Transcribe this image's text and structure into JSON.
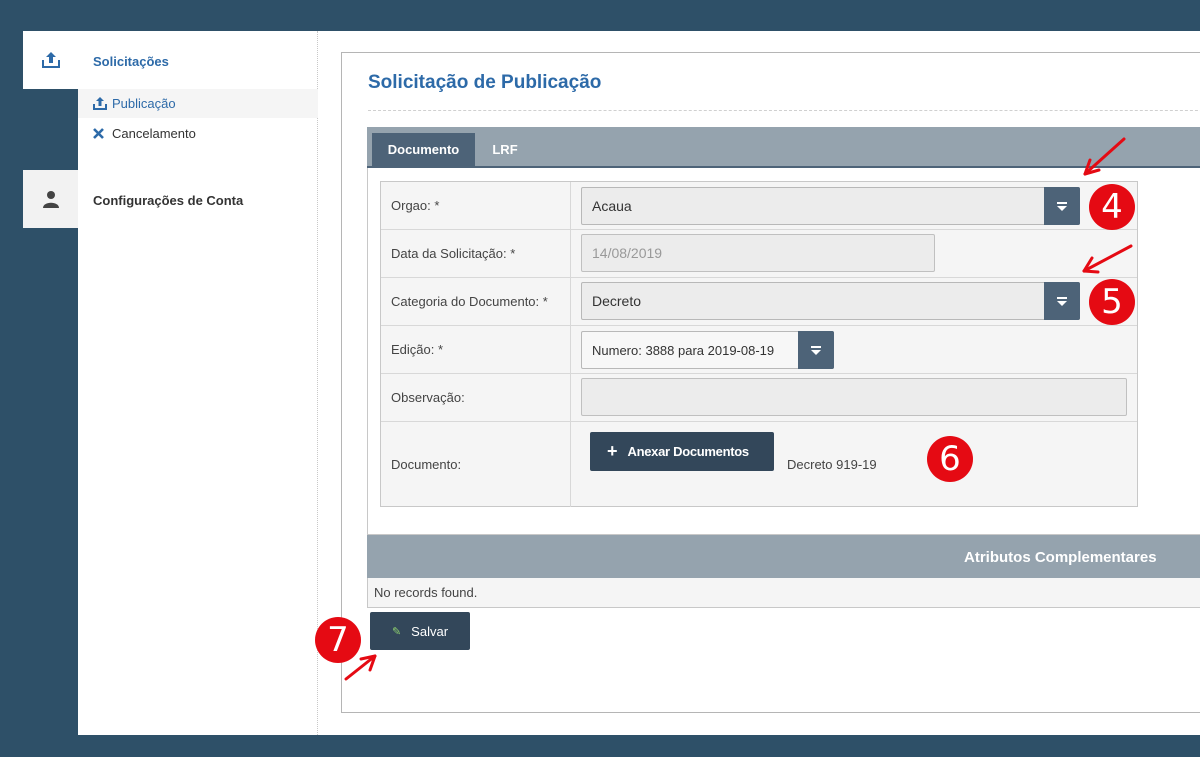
{
  "sidebar": {
    "section_title": "Solicitações",
    "items": [
      {
        "label": "Publicação",
        "icon": "upload-icon",
        "active": true
      },
      {
        "label": "Cancelamento",
        "icon": "close-icon"
      }
    ],
    "account_title": "Configurações de Conta"
  },
  "page": {
    "title": "Solicitação de Publicação",
    "tabs": [
      {
        "label": "Documento",
        "active": true
      },
      {
        "label": "LRF"
      }
    ]
  },
  "form": {
    "orgao": {
      "label": "Orgao: *",
      "value": "Acaua"
    },
    "data": {
      "label": "Data da Solicitação: *",
      "value": "14/08/2019"
    },
    "categoria": {
      "label": "Categoria do Documento: *",
      "value": "Decreto"
    },
    "edicao": {
      "label": "Edição: *",
      "value": "Numero: 3888 para 2019-08-19"
    },
    "observacao": {
      "label": "Observação:",
      "value": ""
    },
    "documento": {
      "label": "Documento:",
      "button_label": "Anexar Documentos",
      "file_name": "Decreto 919-19"
    }
  },
  "attributes": {
    "title": "Atributos Complementares",
    "empty_message": "No records found."
  },
  "actions": {
    "save_label": "Salvar"
  },
  "annotations": [
    "4",
    "5",
    "6",
    "7"
  ],
  "colors": {
    "frame": "#2e5068",
    "accent_blue": "#2d6aa8",
    "header_gray": "#95a3ae",
    "button_dark": "#33475a",
    "annotation_red": "#e50a13"
  }
}
